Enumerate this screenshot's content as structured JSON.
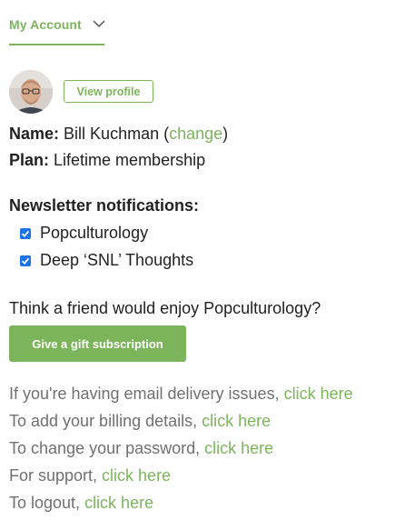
{
  "account_tab": {
    "label": "My Account"
  },
  "profile": {
    "view_profile_label": "View profile"
  },
  "account_info": {
    "name_label": "Name:",
    "name_value": "Bill Kuchman",
    "open_paren": "(",
    "change_link": "change",
    "close_paren": ")",
    "plan_label": "Plan:",
    "plan_value": "Lifetime membership"
  },
  "newsletters": {
    "heading": "Newsletter notifications:",
    "items": [
      {
        "label": "Popculturology",
        "checked": true
      },
      {
        "label": "Deep ‘SNL’ Thoughts",
        "checked": true
      }
    ]
  },
  "gift": {
    "prompt": "Think a friend would enjoy Popculturology?",
    "button_label": "Give a gift subscription"
  },
  "help_links": [
    {
      "text": "If you're having email delivery issues, ",
      "link": "click here"
    },
    {
      "text": "To add your billing details, ",
      "link": "click here"
    },
    {
      "text": "To change your password, ",
      "link": "click here"
    },
    {
      "text": "For support, ",
      "link": "click here"
    },
    {
      "text": "To logout, ",
      "link": "click here"
    }
  ],
  "colors": {
    "accent": "#7cb45c",
    "checkbox": "#1a73e8",
    "muted_text": "#707070"
  }
}
